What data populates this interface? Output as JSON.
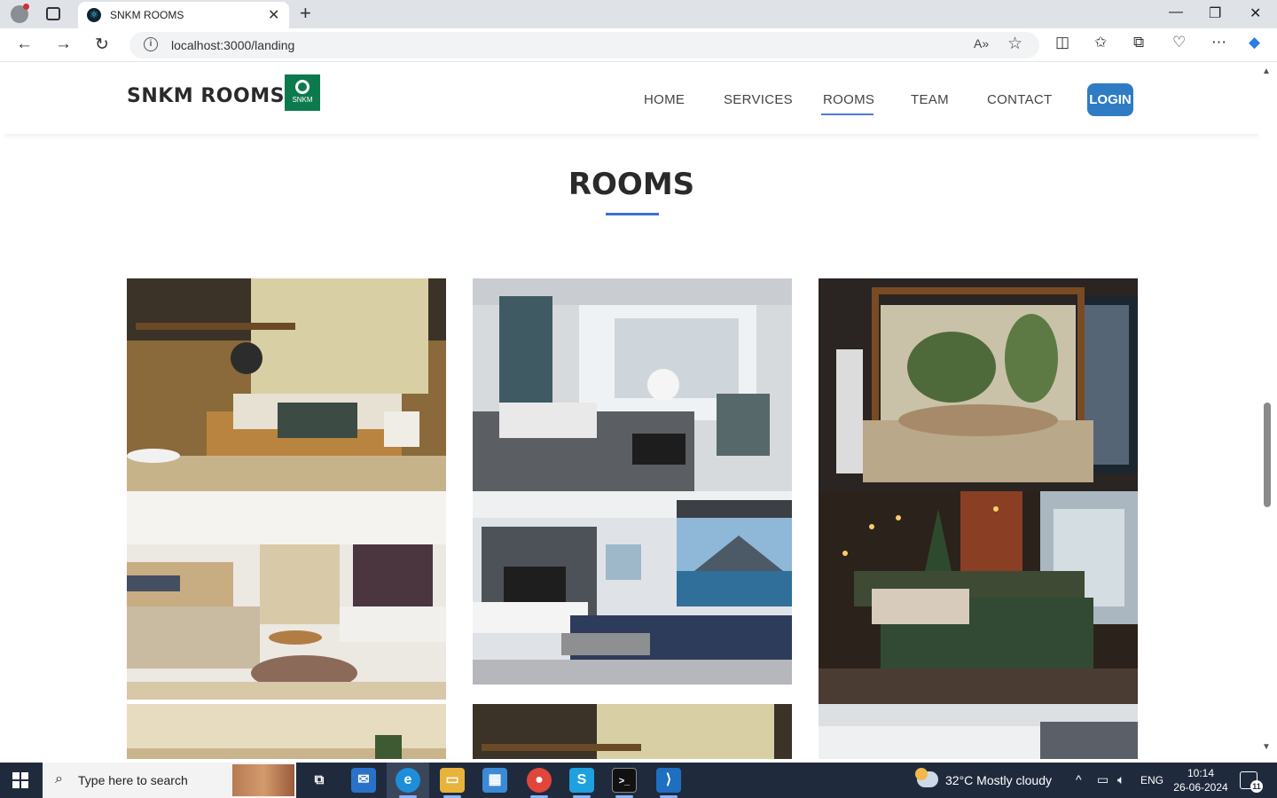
{
  "browser": {
    "tab_title": "SNKM ROOMS",
    "url": "localhost:3000/landing",
    "new_tab_symbol": "+",
    "close_symbol": "✕",
    "read_aloud_icon": "read-aloud-icon",
    "favorite_icon": "star-icon"
  },
  "site": {
    "brand": "SNKM ROOMS",
    "logo_small_text": "SNKM",
    "nav": [
      {
        "label": "HOME"
      },
      {
        "label": "SERVICES"
      },
      {
        "label": "ROOMS",
        "active": true
      },
      {
        "label": "TEAM"
      },
      {
        "label": "CONTACT"
      }
    ],
    "login_label": "LOGIN",
    "section_title": "ROOMS",
    "accent_color": "#3d6fd1",
    "login_color": "#2f7cc4",
    "rooms": [
      {
        "name": "room-photo-cozy-bedroom"
      },
      {
        "name": "room-photo-bright-bedroom"
      },
      {
        "name": "room-photo-canopy-bedroom"
      },
      {
        "name": "room-photo-living-room-stairs"
      },
      {
        "name": "room-photo-living-room-sea-view"
      },
      {
        "name": "room-photo-christmas-bedroom"
      },
      {
        "name": "room-photo-minimal-room"
      },
      {
        "name": "room-photo-cozy-bedroom-2"
      },
      {
        "name": "room-photo-bright-room"
      }
    ]
  },
  "taskbar": {
    "search_placeholder": "Type here to search",
    "weather": "32°C  Mostly cloudy",
    "language": "ENG",
    "time": "10:14",
    "date": "26-06-2024",
    "notification_count": "11",
    "apps": [
      "task-view",
      "mail",
      "edge",
      "file-explorer",
      "store",
      "chrome",
      "skype",
      "terminal",
      "vscode"
    ]
  }
}
